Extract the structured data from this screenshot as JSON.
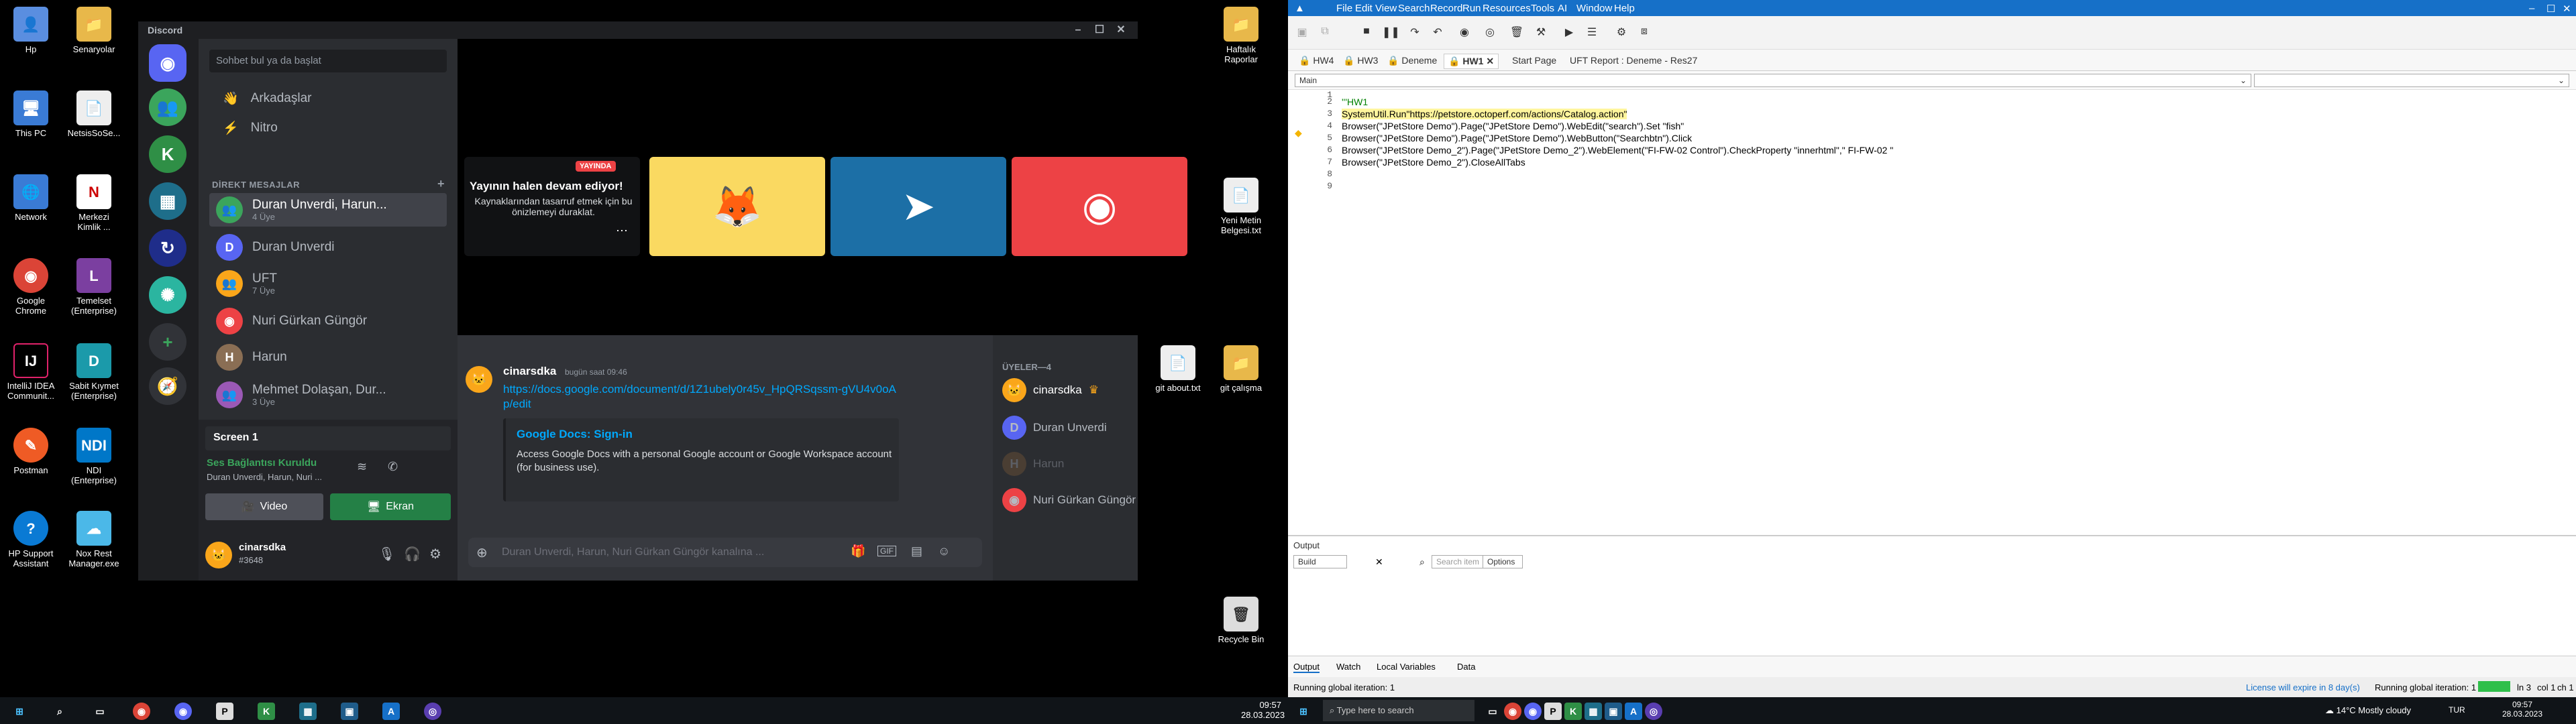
{
  "desktop_left": {
    "icons": [
      "Hp",
      "Senaryolar",
      "This PC",
      "NetsisSoSe...",
      "Network",
      "Merkezi Kimlik ...",
      "Google Chrome",
      "Temelset (Enterprise)",
      "IntelliJ IDEA Communit...",
      "Sabit Kıymet (Enterprise)",
      "Postman",
      "NDI (Enterprise)",
      "HP Support Assistant",
      "Nox Rest Manager.exe",
      "Haftalık Raporlar",
      "Yeni Metin Belgesi.txt",
      "git about.txt",
      "git çalışma",
      "Recycle Bin"
    ]
  },
  "discord": {
    "title": "Discord",
    "search_placeholder": "Sohbet bul ya da başlat",
    "nav": [
      "Arkadaşlar",
      "Nitro"
    ],
    "dm_header": "DİREKT MESAJLAR",
    "dm_add": "+",
    "dms": [
      {
        "name": "Duran Unverdi, Harun...",
        "sub": "4 Üye",
        "color": "#3ba55c"
      },
      {
        "name": "Duran Unverdi",
        "sub": "",
        "color": "#5865f2"
      },
      {
        "name": "UFT",
        "sub": "7 Üye",
        "color": "#faa61a"
      },
      {
        "name": "Nuri Gürkan Güngör",
        "sub": "",
        "color": "#ed4245"
      },
      {
        "name": "Harun",
        "sub": "",
        "color": "#8a6e54"
      },
      {
        "name": "Mehmet Dolaşan, Dur...",
        "sub": "3 Üye",
        "color": "#9b59b6"
      }
    ],
    "screen_label": "Screen 1",
    "voice_status": "Ses Bağlantısı Kuruldu",
    "voice_sub": "Duran Unverdi, Harun, Nuri ...",
    "video_label": "Video",
    "screen_btn": "Ekran",
    "username": "cinarsdka",
    "tag": "#3648",
    "live_badge": "YAYINDA",
    "live_title": "Yayının halen devam ediyor!",
    "live_desc": "Kaynaklarından tasarruf etmek için bu önizlemeyi duraklat.",
    "message": {
      "author": "cinarsdka",
      "time": "bugün saat 09:46",
      "link": "https://docs.google.com/document/d/1Z1ubely0r45v_HpQRSqssm-gVU4v0oAp/edit",
      "embed_title": "Google Docs: Sign-in",
      "embed_desc": "Access Google Docs with a personal Google account or Google Workspace account (for business use)."
    },
    "input_placeholder": "Duran Unverdi, Harun, Nuri Gürkan Güngör kanalına ...",
    "members_header": "ÜYELER—4",
    "members": [
      "cinarsdka",
      "Duran Unverdi",
      "Harun",
      "Nuri Gürkan Güngör"
    ],
    "time_left": "09:57",
    "date_left": "28.03.2023"
  },
  "uft": {
    "menu": [
      "File",
      "Edit",
      "View",
      "Search",
      "Record",
      "Run",
      "Resources",
      "Tools",
      "AI",
      "Window",
      "Help"
    ],
    "tabs": [
      "HW4",
      "HW3",
      "Deneme",
      "HW1",
      "Start Page",
      "UFT Report : Deneme - Res27"
    ],
    "scope": "Main",
    "lines": [
      "1",
      "2",
      "3",
      "4",
      "5",
      "6",
      "7",
      "8",
      "9"
    ],
    "code": [
      "",
      "'''HW1",
      "SystemUtil.Run\"https://petstore.octoperf.com/actions/Catalog.action\"",
      "Browser(\"JPetStore Demo\").Page(\"JPetStore Demo\").WebEdit(\"search\").Set \"fish\"",
      "Browser(\"JPetStore Demo\").Page(\"JPetStore Demo\").WebButton(\"Searchbtn\").Click",
      "Browser(\"JPetStore Demo_2\").Page(\"JPetStore Demo_2\").WebElement(\"FI-FW-02 Control\").CheckProperty \"innerhtml\",\" FI-FW-02 \"",
      "Browser(\"JPetStore Demo_2\").CloseAllTabs",
      "",
      ""
    ],
    "output_title": "Output",
    "output_select": "Build",
    "search_item": "Search item",
    "options": "Options",
    "bottom_tabs": [
      "Output",
      "Watch",
      "Local Variables",
      "Data"
    ],
    "status_left": "Running global iteration: 1",
    "license": "License will expire in 8 day(s)",
    "status_run": "Running global iteration: 1",
    "ln": "ln 3",
    "col": "col 1",
    "ch": "ch 1",
    "weather": "14°C  Mostly cloudy",
    "lang": "TUR",
    "time": "09:57",
    "date": "28.03.2023",
    "search_taskbar": "Type here to search"
  }
}
